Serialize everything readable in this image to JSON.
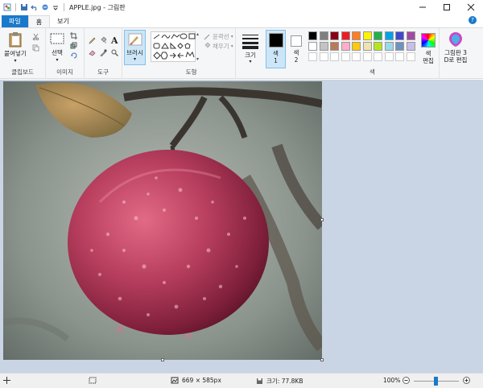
{
  "window": {
    "title": "APPLE.jpg - 그림판"
  },
  "tabs": [
    {
      "label": "파일"
    },
    {
      "label": "홈"
    },
    {
      "label": "보기"
    }
  ],
  "ribbon": {
    "clipboard": {
      "paste": "붙여넣기",
      "group": "클립보드"
    },
    "image": {
      "select": "선택",
      "group": "이미지"
    },
    "tools": {
      "group": "도구"
    },
    "brush": {
      "label": "브러시"
    },
    "shapes": {
      "outline": "윤곽선",
      "fill": "채우기",
      "group": "도형"
    },
    "size": {
      "label": "크기"
    },
    "color1": {
      "label": "색\n1"
    },
    "color2": {
      "label": "색\n2"
    },
    "colors": {
      "group": "색",
      "edit": "색\n편집"
    },
    "paint3d": {
      "label": "그림판 3\nD로 편집"
    }
  },
  "palette_row1": [
    "#000000",
    "#7f7f7f",
    "#880015",
    "#ed1c24",
    "#ff7f27",
    "#fff200",
    "#22b14c",
    "#00a2e8",
    "#3f48cc",
    "#a349a4"
  ],
  "palette_row2": [
    "#ffffff",
    "#c3c3c3",
    "#b97a57",
    "#ffaec9",
    "#ffc90e",
    "#efe4b0",
    "#b5e61d",
    "#99d9ea",
    "#7092be",
    "#c8bfe7"
  ],
  "status": {
    "dimensions": "669 × 585px",
    "filesize": "크기: 77.8KB",
    "zoom": "100%"
  },
  "colors": {
    "accent": "#1979ca",
    "canvas_bg": "#c9d4e4"
  }
}
